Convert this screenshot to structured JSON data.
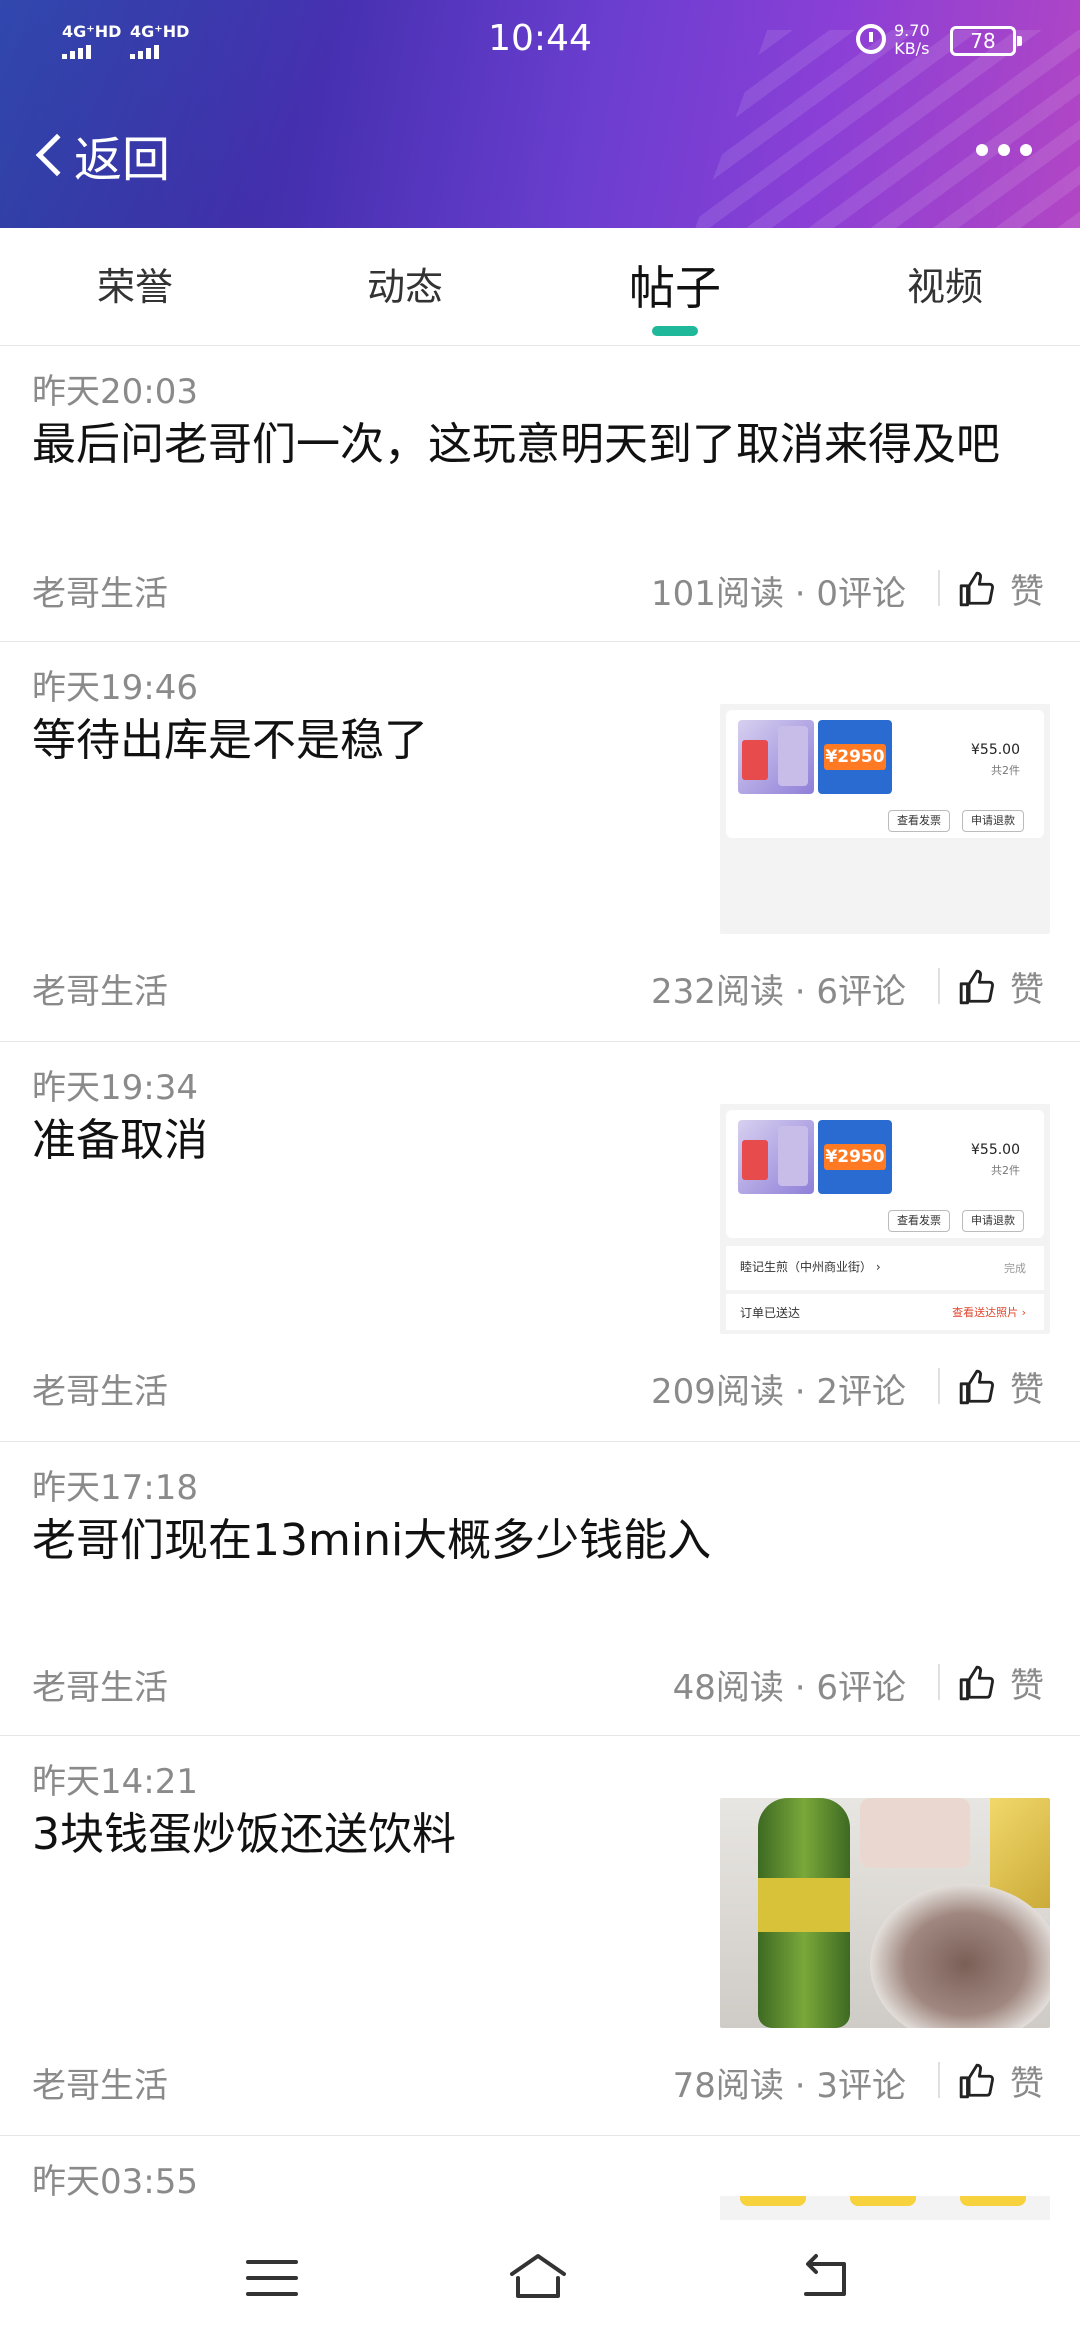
{
  "status_bar": {
    "network_1": "4G⁺HD",
    "network_2": "4G⁺HD",
    "time": "10:44",
    "speed_value": "9.70",
    "speed_unit": "KB/s",
    "battery": "78"
  },
  "header": {
    "back_label": "返回"
  },
  "tabs": [
    {
      "label": "荣誉"
    },
    {
      "label": "动态"
    },
    {
      "label": "帖子"
    },
    {
      "label": "视频"
    }
  ],
  "active_tab": "帖子",
  "posts": [
    {
      "time": "昨天20:03",
      "title": "最后问老哥们一次，这玩意明天到了取消来得及吧",
      "author": "老哥生活",
      "stats": "101阅读 · 0评论",
      "like": "赞"
    },
    {
      "time": "昨天19:46",
      "title": "等待出库是不是稳了",
      "author": "老哥生活",
      "stats": "232阅读 · 6评论",
      "like": "赞"
    },
    {
      "time": "昨天19:34",
      "title": "准备取消",
      "author": "老哥生活",
      "stats": "209阅读 · 2评论",
      "like": "赞"
    },
    {
      "time": "昨天17:18",
      "title": "老哥们现在13mini大概多少钱能入",
      "author": "老哥生活",
      "stats": "48阅读 · 6评论",
      "like": "赞"
    },
    {
      "time": "昨天14:21",
      "title": "3块钱蛋炒饭还送饮料",
      "author": "老哥生活",
      "stats": "78阅读 · 3评论",
      "like": "赞"
    },
    {
      "time": "昨天03:55"
    }
  ],
  "order_thumb": {
    "promo_price": "¥2950",
    "price": "¥55.00",
    "qty": "共2件",
    "btn_invoice": "查看发票",
    "btn_refund": "申请退款",
    "shop": "睦记生煎（中州商业街） ›",
    "status_done": "完成",
    "delivered": "订单已送达",
    "delivered_link": "查看送达照片 ›"
  },
  "colors": {
    "accent": "#1fb89a",
    "header_gradient_start": "#2a2a8c",
    "header_gradient_end": "#b246c4",
    "muted_text": "#8a8a8a"
  },
  "icons": {
    "like": "thumbs-up-icon",
    "more": "more-dots-icon",
    "back": "chevron-left-icon",
    "nav_menu": "menu-lines-icon",
    "nav_home": "home-icon",
    "nav_back": "return-arrow-icon"
  }
}
